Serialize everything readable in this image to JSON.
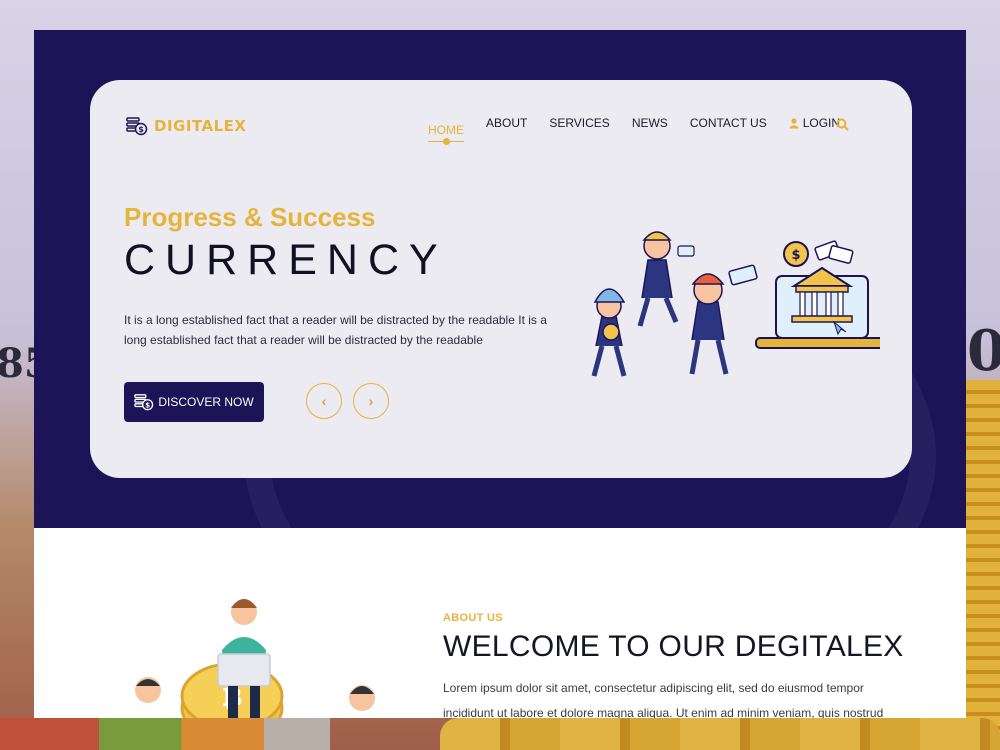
{
  "brand": {
    "name": "DIGITALEX"
  },
  "nav": {
    "items": [
      {
        "label": "HOME",
        "active": true
      },
      {
        "label": "ABOUT"
      },
      {
        "label": "SERVICES"
      },
      {
        "label": "NEWS"
      },
      {
        "label": "CONTACT US"
      }
    ],
    "login_label": "LOGIN",
    "search_icon": "search-icon"
  },
  "hero": {
    "subtitle": "Progress & Success",
    "title": "CURRENCY",
    "description": "It is a long established fact that a reader will be distracted by the readable It is a long established fact that a reader will be distracted by the readable",
    "cta_label": "DISCOVER NOW",
    "prev_icon": "chevron-left-icon",
    "next_icon": "chevron-right-icon"
  },
  "about": {
    "eyebrow": "ABOUT US",
    "title": "WELCOME TO OUR DEGITALEX",
    "description": "Lorem ipsum dolor sit amet, consectetur adipiscing elit, sed do eiusmod tempor incididunt ut labore et dolore magna aliqua. Ut enim ad minim veniam, quis nostrud"
  },
  "colors": {
    "accent": "#e5b43b",
    "navy": "#1d1458",
    "card": "#ecebf1"
  }
}
